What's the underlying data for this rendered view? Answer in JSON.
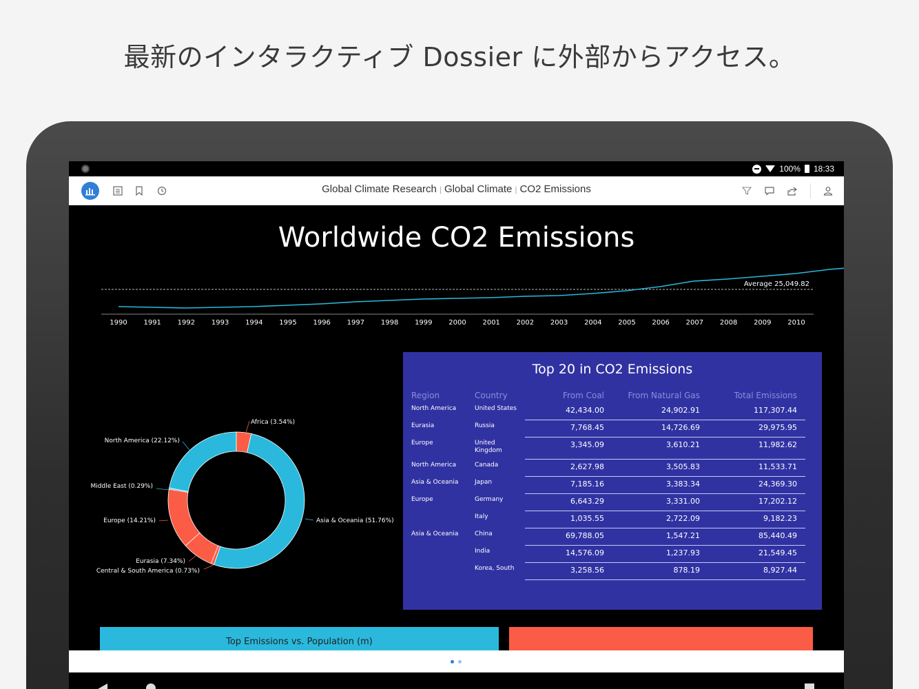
{
  "headline": "最新のインタラクティブ Dossier に外部からアクセス。",
  "status_bar": {
    "battery": "100%",
    "time": "18:33"
  },
  "toolbar": {
    "crumbs": [
      "Global Climate Research",
      "Global Climate",
      "CO2 Emissions"
    ],
    "separator": "|"
  },
  "dossier": {
    "title": "Worldwide CO2 Emissions",
    "line_chart": {
      "type": "line",
      "x": [
        "1990",
        "1991",
        "1992",
        "1993",
        "1994",
        "1995",
        "1996",
        "1997",
        "1998",
        "1999",
        "2000",
        "2001",
        "2002",
        "2003",
        "2004",
        "2005",
        "2006",
        "2007",
        "2008",
        "2009",
        "2010"
      ],
      "average_label": "Average 25,049.82",
      "average_value": 25049.82,
      "series_color": "#2ab9dc",
      "grid": false
    },
    "donut": {
      "type": "pie",
      "slices": [
        {
          "label": "Africa (3.54%)",
          "value": 3.54,
          "color": "#fb5c45"
        },
        {
          "label": "Asia & Oceania (51.76%)",
          "value": 51.76,
          "color": "#2ab9dc"
        },
        {
          "label": "Central & South America (0.73%)",
          "value": 0.73,
          "color": "#fb5c45"
        },
        {
          "label": "Eurasia (7.34%)",
          "value": 7.34,
          "color": "#fb5c45"
        },
        {
          "label": "Europe (14.21%)",
          "value": 14.21,
          "color": "#fb5c45"
        },
        {
          "label": "Middle East (0.29%)",
          "value": 0.29,
          "color": "#2ab9dc"
        },
        {
          "label": "North America (22.12%)",
          "value": 22.12,
          "color": "#2ab9dc"
        }
      ]
    },
    "table": {
      "title": "Top 20 in CO2 Emissions",
      "headers": [
        "Region",
        "Country",
        "From Coal",
        "From Natural Gas",
        "Total Emissions"
      ],
      "rows": [
        {
          "region": "North America",
          "country": "United States",
          "coal": "42,434.00",
          "gas": "24,902.91",
          "total": "117,307.44"
        },
        {
          "region": "Eurasia",
          "country": "Russia",
          "coal": "7,768.45",
          "gas": "14,726.69",
          "total": "29,975.95"
        },
        {
          "region": "Europe",
          "country": "United Kingdom",
          "coal": "3,345.09",
          "gas": "3,610.21",
          "total": "11,982.62"
        },
        {
          "region": "North America",
          "country": "Canada",
          "coal": "2,627.98",
          "gas": "3,505.83",
          "total": "11,533.71"
        },
        {
          "region": "Asia & Oceania",
          "country": "Japan",
          "coal": "7,185.16",
          "gas": "3,383.34",
          "total": "24,369.30"
        },
        {
          "region": "Europe",
          "country": "Germany",
          "coal": "6,643.29",
          "gas": "3,331.00",
          "total": "17,202.12"
        },
        {
          "region": "",
          "country": "Italy",
          "coal": "1,035.55",
          "gas": "2,722.09",
          "total": "9,182.23"
        },
        {
          "region": "Asia & Oceania",
          "country": "China",
          "coal": "69,788.05",
          "gas": "1,547.21",
          "total": "85,440.49"
        },
        {
          "region": "",
          "country": "India",
          "coal": "14,576.09",
          "gas": "1,237.93",
          "total": "21,549.45"
        },
        {
          "region": "",
          "country": "Korea, South",
          "coal": "3,258.56",
          "gas": "878.19",
          "total": "8,927.44"
        }
      ]
    },
    "bottom_bars": {
      "blue_label": "Top Emissions vs. Population (m)",
      "blue_color": "#2ab9dc",
      "red_color": "#fb5c45"
    }
  },
  "pager": {
    "pages": 2,
    "current_page": 1
  },
  "icons": [
    "dossier-icon",
    "table-of-contents-icon",
    "bookmark-icon",
    "history-icon",
    "filter-icon",
    "comment-icon",
    "share-icon",
    "account-icon"
  ]
}
